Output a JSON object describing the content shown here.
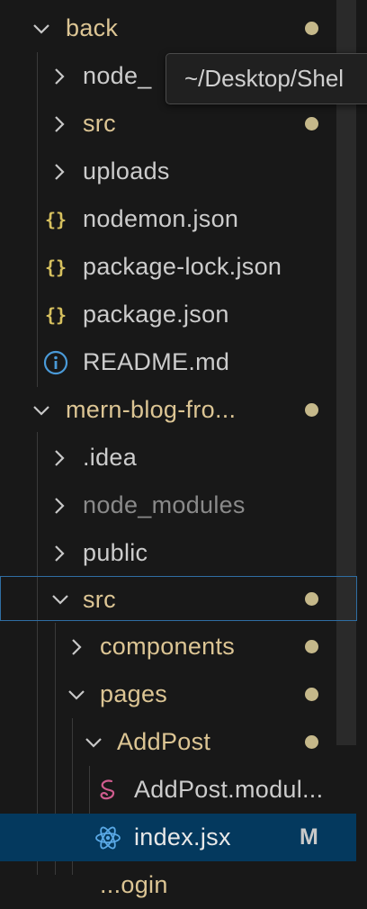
{
  "explorer": {
    "rows": [
      {
        "label": "back",
        "type": "folder",
        "expanded": true,
        "modified_dot": true
      },
      {
        "label": "node_",
        "type": "folder",
        "expanded": false
      },
      {
        "label": "src",
        "type": "folder",
        "expanded": false,
        "modified_dot": true
      },
      {
        "label": "uploads",
        "type": "folder",
        "expanded": false
      },
      {
        "label": "nodemon.json",
        "type": "json",
        "icon": "{}"
      },
      {
        "label": "package-lock.json",
        "type": "json",
        "icon": "{}"
      },
      {
        "label": "package.json",
        "type": "json",
        "icon": "{}"
      },
      {
        "label": "README.md",
        "type": "info",
        "icon": "i"
      },
      {
        "label": "mern-blog-fro...",
        "type": "folder",
        "expanded": true,
        "modified_dot": true
      },
      {
        "label": ".idea",
        "type": "folder",
        "expanded": false
      },
      {
        "label": "node_modules",
        "type": "folder",
        "expanded": false,
        "dimmed": true
      },
      {
        "label": "public",
        "type": "folder",
        "expanded": false
      },
      {
        "label": "src",
        "type": "folder",
        "expanded": true,
        "modified_dot": true,
        "focused": true
      },
      {
        "label": "components",
        "type": "folder",
        "expanded": false,
        "modified_dot": true
      },
      {
        "label": "pages",
        "type": "folder",
        "expanded": true,
        "modified_dot": true
      },
      {
        "label": "AddPost",
        "type": "folder",
        "expanded": true,
        "modified_dot": true
      },
      {
        "label": "AddPost.modul...",
        "type": "scss"
      },
      {
        "label": "index.jsx",
        "type": "react",
        "badge": "M",
        "selected": true
      },
      {
        "label": "...ogin",
        "type": "folder",
        "partial": true
      }
    ]
  },
  "tooltip": {
    "text": "~/Desktop/Shel"
  },
  "colors": {
    "background": "#181818",
    "modified": "#dcc594",
    "dot": "#c5b88a",
    "json_icon": "#d7c15f",
    "info_icon": "#4a9ad8",
    "scss_icon": "#d05c8e",
    "react_icon": "#5aa9e6",
    "selected_bg": "#04395e",
    "focus_border": "#2f6ea3"
  }
}
